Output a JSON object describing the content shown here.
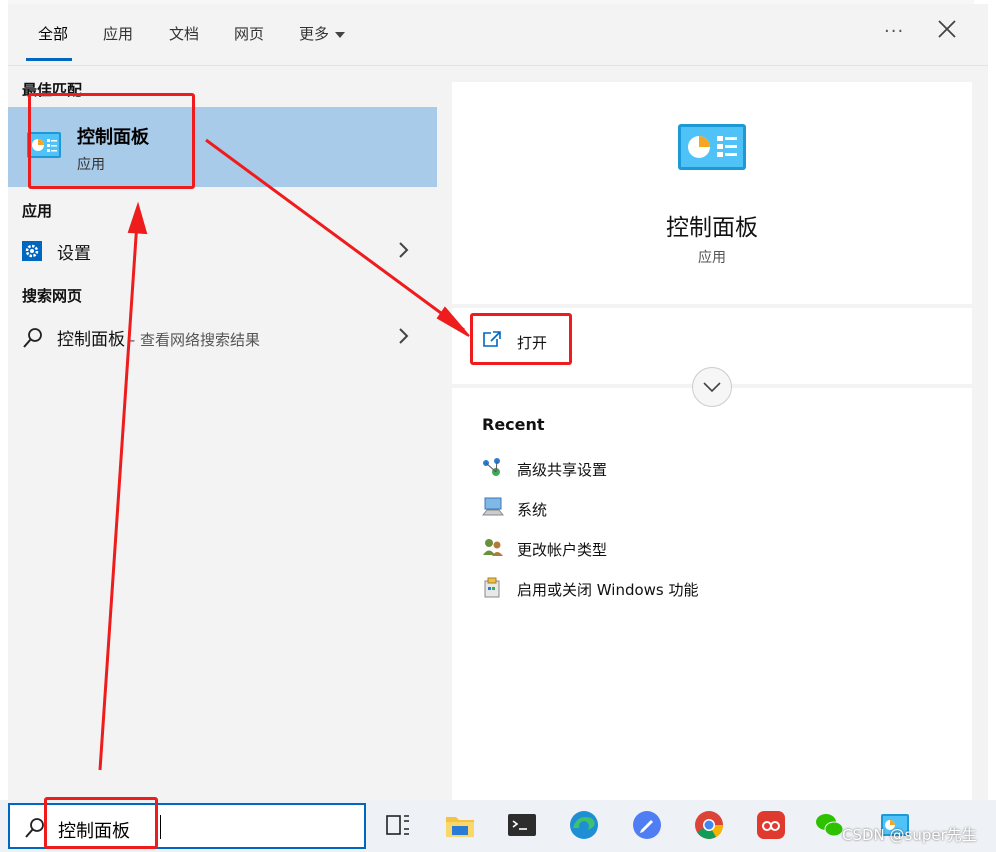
{
  "tabs": [
    {
      "label": "全部",
      "active": true
    },
    {
      "label": "应用"
    },
    {
      "label": "文档"
    },
    {
      "label": "网页"
    },
    {
      "label": "更多"
    }
  ],
  "left": {
    "best_match_header": "最佳匹配",
    "best_match": {
      "title": "控制面板",
      "subtitle": "应用",
      "icon": "control-panel-icon"
    },
    "apps_header": "应用",
    "apps": [
      {
        "label": "设置",
        "icon": "settings-gear-icon"
      }
    ],
    "web_header": "搜索网页",
    "web": [
      {
        "label": "控制面板",
        "sub": " - 查看网络搜索结果",
        "icon": "search-icon"
      }
    ]
  },
  "right": {
    "title": "控制面板",
    "subtitle": "应用",
    "open_label": "打开",
    "recent_header": "Recent",
    "recent": [
      {
        "label": "高级共享设置",
        "icon": "network-sharing-icon"
      },
      {
        "label": "系统",
        "icon": "computer-system-icon"
      },
      {
        "label": "更改帐户类型",
        "icon": "user-accounts-icon"
      },
      {
        "label": "启用或关闭 Windows 功能",
        "icon": "windows-features-icon"
      }
    ]
  },
  "taskbar": {
    "search_value": "控制面板",
    "apps": [
      "task-view-icon",
      "file-explorer-icon",
      "terminal-icon",
      "edge-icon",
      "feishu-icon",
      "chrome-icon",
      "netease-icon",
      "wechat-icon",
      "control-panel-taskbar-icon"
    ],
    "watermark": "CSDN @super先生"
  },
  "colors": {
    "accent": "#0067c0",
    "selection": "#a9cbea",
    "annotation": "#ee1c1c"
  }
}
